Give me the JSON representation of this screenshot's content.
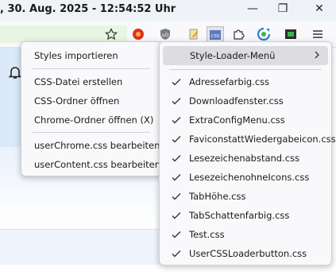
{
  "window": {
    "title": ", 30. Aug. 2025 - 12:54:52 Uhr",
    "minimize_icon": "minimize-icon",
    "restore_icon": "restore-icon",
    "close_icon": "close-icon"
  },
  "toolbar": {
    "icons": [
      "bookmark-star-icon",
      "red-addon-icon",
      "ublock-icon",
      "pencil-icon",
      "css-icon",
      "puzzle-icon",
      "sync-icon",
      "screenshot-icon",
      "hamburger-menu-icon"
    ]
  },
  "left_menu": {
    "items": [
      {
        "label": "Styles importieren"
      },
      {
        "label": "CSS-Datei erstellen"
      },
      {
        "label": "CSS-Ordner öffnen"
      },
      {
        "label": "Chrome-Ordner öffnen (X)"
      },
      {
        "label": "userChrome.css bearbeiten"
      },
      {
        "label": "userContent.css bearbeiten"
      }
    ]
  },
  "right_menu": {
    "header": "Style-Loader-Menü",
    "items": [
      {
        "label": "Adressefarbig.css",
        "checked": true
      },
      {
        "label": "Downloadfenster.css",
        "checked": true
      },
      {
        "label": "ExtraConfigMenu.css",
        "checked": true
      },
      {
        "label": "FaviconstattWiedergabeicon.css",
        "checked": true
      },
      {
        "label": "Lesezeichenabstand.css",
        "checked": true
      },
      {
        "label": "LesezeichenohneIcons.css",
        "checked": true
      },
      {
        "label": "TabHöhe.css",
        "checked": true
      },
      {
        "label": "TabSchattenfarbig.css",
        "checked": true
      },
      {
        "label": "Test.css",
        "checked": true
      },
      {
        "label": "UserCSSLoaderbutton.css",
        "checked": true
      }
    ]
  },
  "colors": {
    "menu_bg": "#f9f9fb",
    "highlight": "#dcdce1",
    "urlbar": "#e8f5e3"
  }
}
